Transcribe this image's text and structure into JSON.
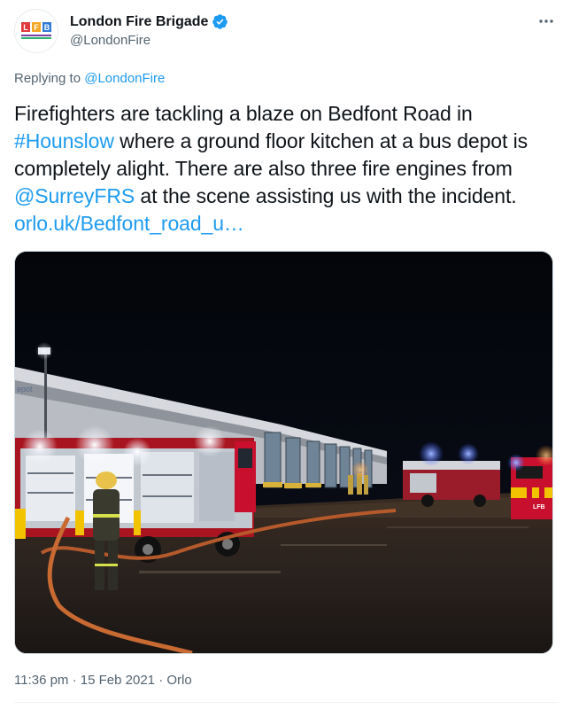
{
  "author": {
    "display_name": "London Fire Brigade",
    "handle": "@LondonFire",
    "avatar_text": "LFB",
    "avatar_subtext": "LONDON FIRE BRIGADE",
    "verified": true
  },
  "reply": {
    "prefix": "Replying to",
    "handle": "@LondonFire"
  },
  "tweet": {
    "t1": "Firefighters are tackling a blaze on Bedfont Road in ",
    "hashtag": "#Hounslow",
    "t2": " where a ground floor kitchen at a bus depot is completely alight. There are also three fire engines from ",
    "mention": "@SurreyFRS",
    "t3": " at the scene assisting us with the incident. ",
    "link": "orlo.uk/Bedfont_road_u…"
  },
  "media": {
    "sign_text": "epot",
    "truck_text": "LFB"
  },
  "meta": {
    "time": "11:36 pm",
    "sep1": " · ",
    "date": "15 Feb 2021",
    "sep2": " · ",
    "source": "Orlo"
  },
  "colors": {
    "link": "#1d9bf0",
    "secondary_text": "#536471",
    "verified_badge": "#1d9bf0",
    "fire_engine_red": "#c8102e"
  },
  "icons": {
    "verified": "verified-badge-icon",
    "more": "more-horizontal-icon"
  }
}
